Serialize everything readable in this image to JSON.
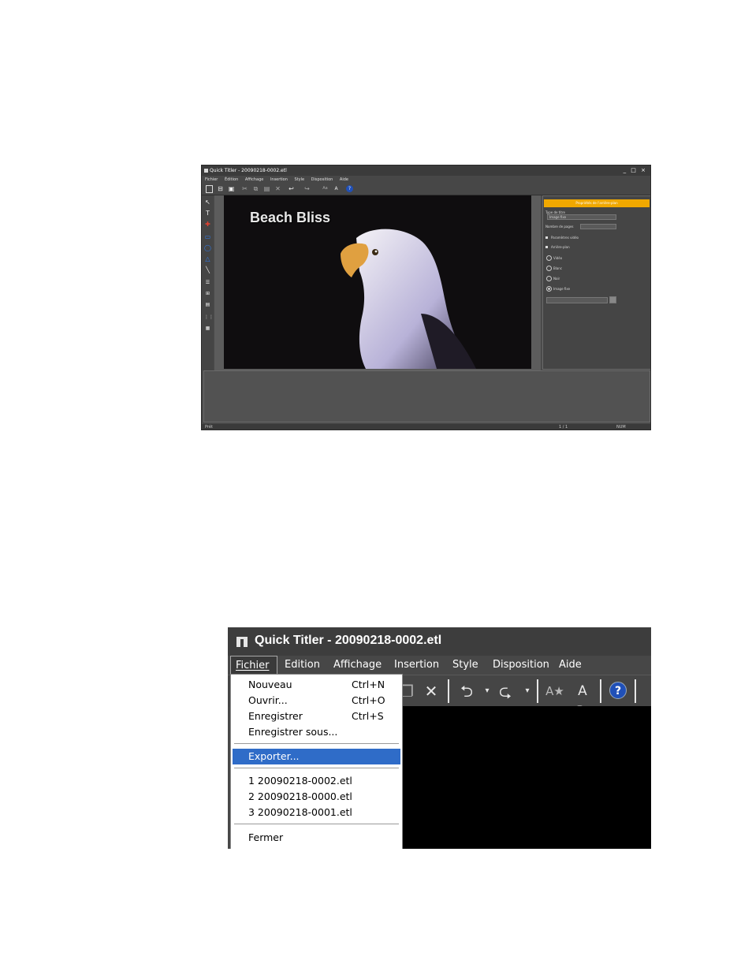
{
  "small_window": {
    "title": "Quick Titler - 20090218-0002.etl",
    "window_controls": "_ □ ×",
    "menu": [
      "Fichier",
      "Édition",
      "Affichage",
      "Insertion",
      "Style",
      "Disposition",
      "Aide"
    ],
    "canvas_title": "Beach Bliss",
    "panel": {
      "header": "Propriétés de l'arrière-plan",
      "title_type_label": "Type de titre",
      "title_type_value": "Image fixe",
      "pages_label": "Nombre de pages",
      "video_params": "Paramètres vidéo",
      "background": "Arrière-plan",
      "opt_video": "Vidéo",
      "opt_blank": "Blanc",
      "opt_black": "Noir",
      "opt_still": "Image fixe"
    },
    "status": {
      "left": "Prêt",
      "page": "1 / 1",
      "num": "NUM"
    }
  },
  "window": {
    "title": "Quick Titler - 20090218-0002.etl",
    "menu": {
      "fichier": "Fichier",
      "edition": "Edition",
      "affichage": "Affichage",
      "insertion": "Insertion",
      "style": "Style",
      "disposition": "Disposition",
      "aide": "Aide"
    },
    "file_menu": {
      "nouveau": {
        "label": "Nouveau",
        "shortcut": "Ctrl+N"
      },
      "ouvrir": {
        "label": "Ouvrir...",
        "shortcut": "Ctrl+O"
      },
      "enregistrer": {
        "label": "Enregistrer",
        "shortcut": "Ctrl+S"
      },
      "enregistrer_sous": {
        "label": "Enregistrer sous..."
      },
      "exporter": {
        "label": "Exporter..."
      },
      "recent": [
        "1 20090218-0002.etl",
        "2 20090218-0000.etl",
        "3 20090218-0001.etl"
      ],
      "fermer": {
        "label": "Fermer"
      }
    },
    "help_glyph": "?"
  }
}
